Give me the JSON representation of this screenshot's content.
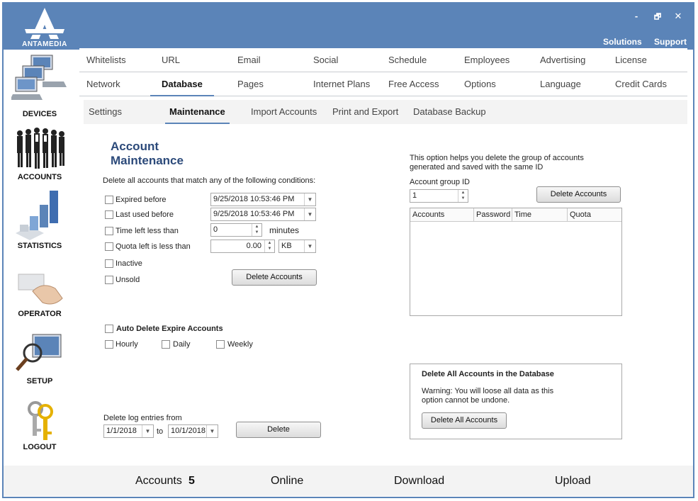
{
  "app": {
    "logo_text": "ANTAMEDIA"
  },
  "window": {
    "minimize": "-",
    "restore": "🗗",
    "close": "✕"
  },
  "toplinks": {
    "solutions": "Solutions",
    "support": "Support"
  },
  "sidebar": [
    {
      "label": "DEVICES",
      "icon": "computers-icon"
    },
    {
      "label": "ACCOUNTS",
      "icon": "people-icon"
    },
    {
      "label": "STATISTICS",
      "icon": "bar-chart-icon"
    },
    {
      "label": "OPERATOR",
      "icon": "hand-card-icon"
    },
    {
      "label": "SETUP",
      "icon": "magnifier-monitor-icon"
    },
    {
      "label": "LOGOUT",
      "icon": "keys-icon"
    }
  ],
  "nav": {
    "row1": [
      "Whitelists",
      "URL",
      "Email",
      "Social",
      "Schedule",
      "Employees",
      "Advertising",
      "License"
    ],
    "row2": [
      "Network",
      "Database",
      "Pages",
      "Internet Plans",
      "Free Access",
      "Options",
      "Language",
      "Credit Cards"
    ],
    "active": "Database"
  },
  "subnav": {
    "tabs": [
      "Settings",
      "Maintenance",
      "Import Accounts",
      "Print and Export",
      "Database Backup"
    ],
    "active": "Maintenance"
  },
  "maintenance": {
    "title": "Account Maintenance",
    "conditions_label": "Delete all accounts that match any of the following conditions:",
    "expired_before": {
      "label": "Expired before",
      "value": "9/25/2018 10:53:46 PM"
    },
    "last_used_before": {
      "label": "Last used before",
      "value": "9/25/2018 10:53:46 PM"
    },
    "time_left": {
      "label": "Time left less than",
      "value": "0",
      "unit": "minutes"
    },
    "quota_left": {
      "label": "Quota left is less than",
      "value": "0.00",
      "unit": "KB"
    },
    "inactive": "Inactive",
    "unsold": "Unsold",
    "delete_button": "Delete Accounts",
    "auto_delete": {
      "label": "Auto Delete Expire Accounts",
      "hourly": "Hourly",
      "daily": "Daily",
      "weekly": "Weekly"
    },
    "log": {
      "label": "Delete log entries from",
      "from": "1/1/2018",
      "to_label": "to",
      "to": "10/1/2018",
      "button": "Delete"
    }
  },
  "group": {
    "description": "This option helps you delete the group of accounts generated and saved with the same ID",
    "id_label": "Account group ID",
    "id_value": "1",
    "button": "Delete Accounts",
    "columns": [
      "Accounts",
      "Password",
      "Time",
      "Quota"
    ]
  },
  "delete_all": {
    "title": "Delete All Accounts in the Database",
    "warning": "Warning: You will loose all data as this option cannot be undone.",
    "button": "Delete All Accounts"
  },
  "status": {
    "accounts_label": "Accounts",
    "accounts_count": "5",
    "online": "Online",
    "download": "Download",
    "upload": "Upload"
  },
  "colors": {
    "accent": "#5b84b8",
    "title": "#2c4a7a"
  }
}
